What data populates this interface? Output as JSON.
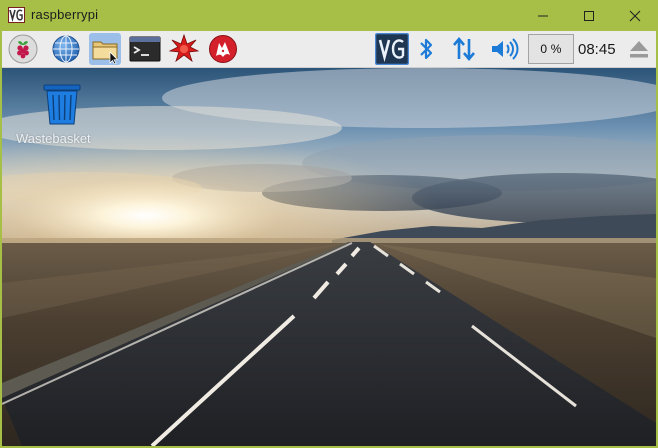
{
  "window": {
    "app_icon": "vnc-logo-icon",
    "title": "raspberrypi",
    "controls": [
      "minimize-icon",
      "maximize-icon",
      "close-icon"
    ]
  },
  "taskbar": {
    "launchers": [
      {
        "name": "raspberry-menu",
        "icon": "raspberry-icon"
      },
      {
        "name": "web-browser",
        "icon": "globe-icon"
      },
      {
        "name": "file-manager",
        "icon": "folder-icon",
        "active": true
      },
      {
        "name": "terminal",
        "icon": "terminal-icon"
      },
      {
        "name": "mathematica",
        "icon": "spiky-star-icon"
      },
      {
        "name": "wolfram",
        "icon": "wolf-icon"
      }
    ],
    "tray": {
      "vnc_icon": "vnc-server-icon",
      "bluetooth_icon": "bluetooth-icon",
      "network_icon": "network-arrows-icon",
      "volume_icon": "speaker-icon",
      "cpu_usage": "0 %",
      "clock": "08:45",
      "eject_icon": "eject-icon"
    }
  },
  "desktop": {
    "wallpaper": "sunset-road",
    "icons": [
      {
        "label": "Wastebasket",
        "icon": "wastebasket-icon"
      }
    ]
  },
  "colors": {
    "title_bar": "#a7bf47",
    "taskbar": "#ececec",
    "tray_icon_blue": "#1d7bd8"
  }
}
